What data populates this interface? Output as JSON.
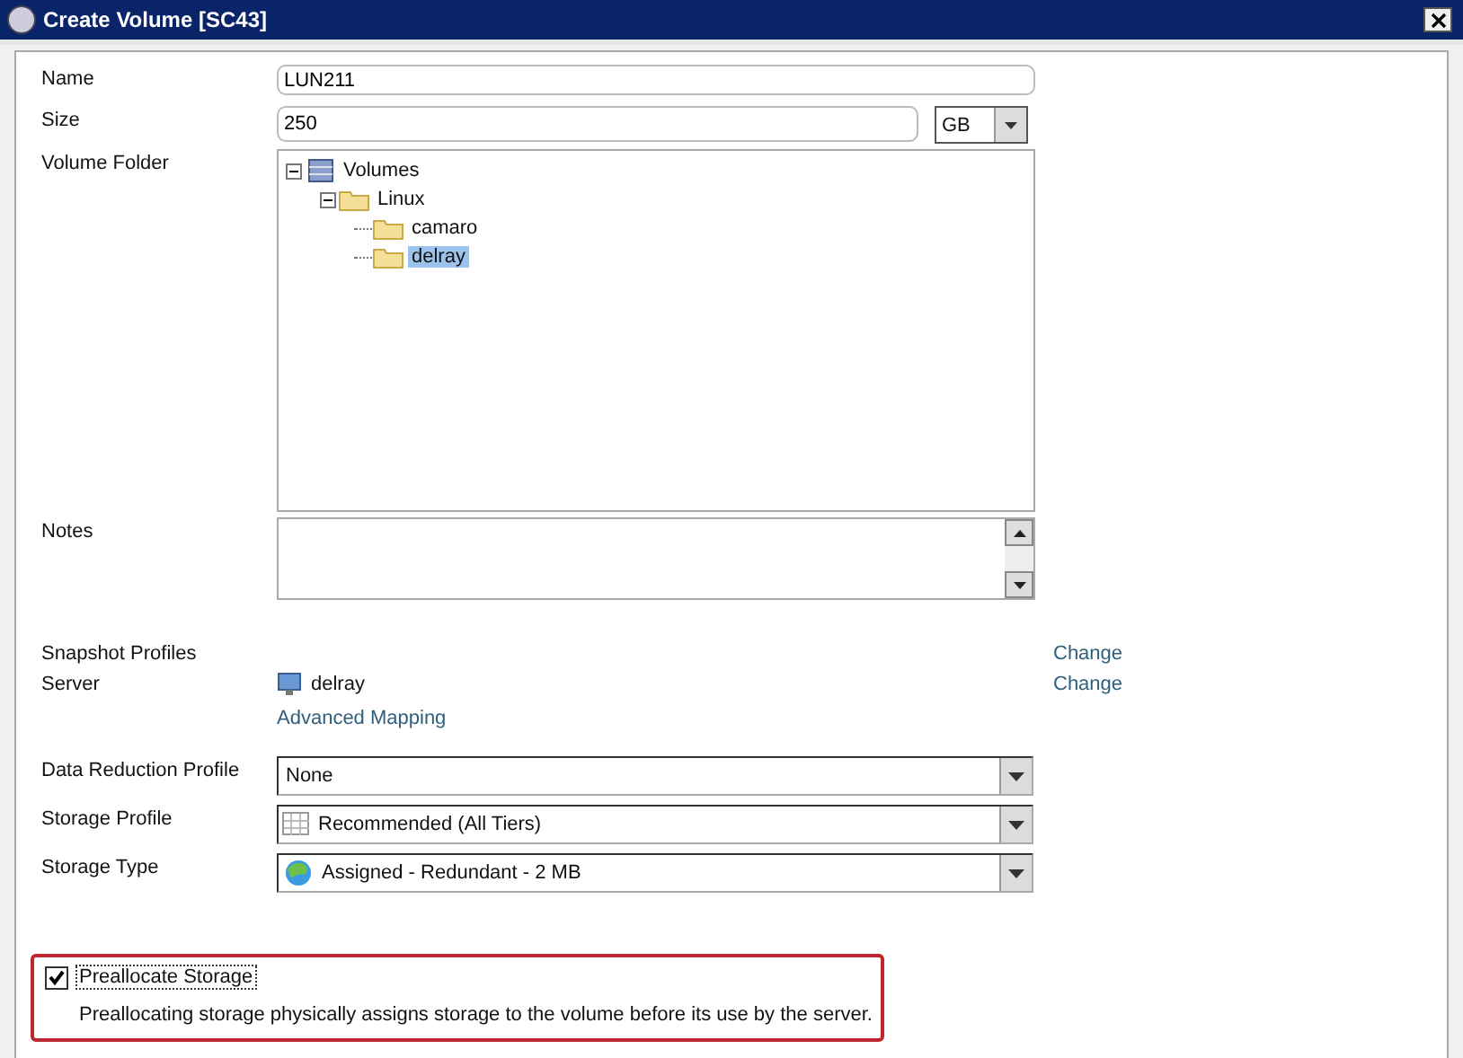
{
  "window": {
    "title": "Create Volume [SC43]"
  },
  "name": {
    "label": "Name",
    "value": "LUN211"
  },
  "size": {
    "label": "Size",
    "value": "250",
    "unit": "GB"
  },
  "volume_folder": {
    "label": "Volume Folder",
    "tree": [
      {
        "label": "Volumes",
        "kind": "volumes",
        "expanded": true,
        "selected": false,
        "children": [
          {
            "label": "Linux",
            "kind": "folder",
            "expanded": true,
            "selected": false,
            "children": [
              {
                "label": "camaro",
                "kind": "folder",
                "selected": false
              },
              {
                "label": "delray",
                "kind": "folder",
                "selected": true
              }
            ]
          }
        ]
      }
    ]
  },
  "notes": {
    "label": "Notes"
  },
  "snapshot_profiles": {
    "label": "Snapshot Profiles",
    "link": "Change"
  },
  "server": {
    "label": "Server",
    "value": "delray",
    "link": "Change",
    "advanced_link": "Advanced Mapping"
  },
  "dropdowns": [
    {
      "label": "Data Reduction Profile",
      "value": "None"
    },
    {
      "label": "Storage Profile",
      "value": "Recommended (All Tiers)"
    },
    {
      "label": "Storage Type",
      "value": "Assigned - Redundant - 2 MB"
    }
  ],
  "preallocate": {
    "label": "Preallocate Storage",
    "checked": true,
    "description": "Preallocating storage physically assigns storage to the volume before its use by the server."
  }
}
